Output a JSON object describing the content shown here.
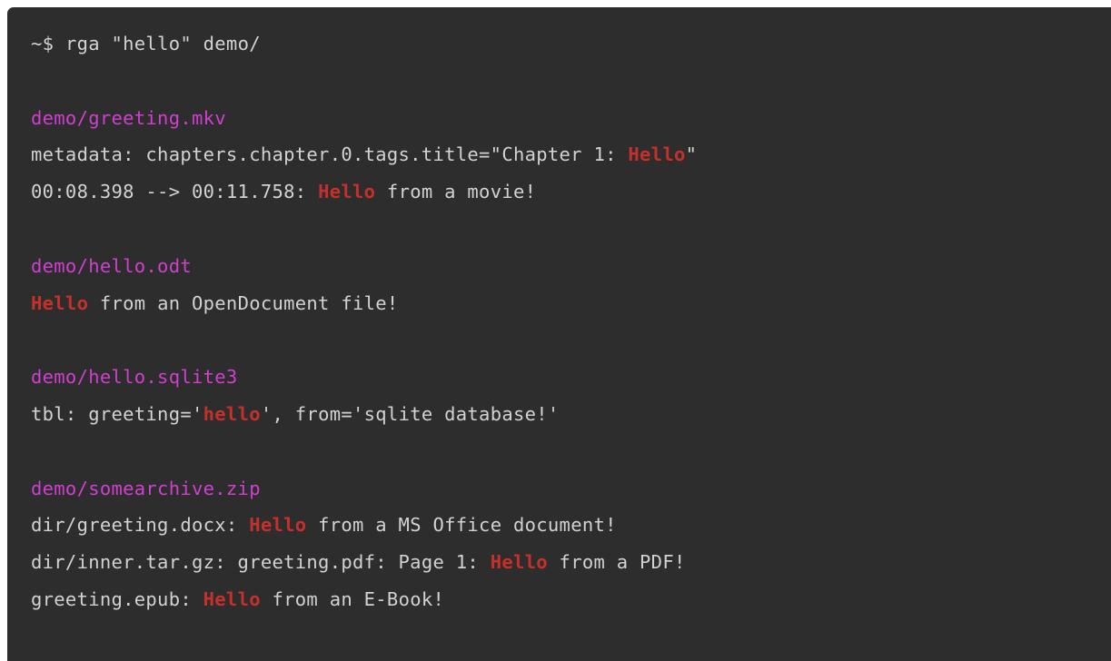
{
  "terminal": {
    "background_color": "#2d2d2d",
    "foreground_color": "#d2d2d2",
    "path_color": "#d13fd1",
    "match_color": "#c6302a",
    "page_background_color": "#ffffff",
    "command": "~$ rga \"hello\" demo/",
    "prompt": "~$ ",
    "program": "rga",
    "query": "hello",
    "search_path": "demo/",
    "lines": [
      {
        "type": "command",
        "segments": [
          {
            "kind": "prompt",
            "text": "~$ "
          },
          {
            "kind": "normal",
            "text": "rga \"hello\" demo/"
          }
        ]
      },
      {
        "type": "blank",
        "segments": []
      },
      {
        "type": "filename",
        "segments": [
          {
            "kind": "path",
            "text": "demo/greeting.mkv"
          }
        ]
      },
      {
        "type": "result",
        "segments": [
          {
            "kind": "normal",
            "text": "metadata: chapters.chapter.0.tags.title=\"Chapter 1: "
          },
          {
            "kind": "match",
            "text": "Hello"
          },
          {
            "kind": "normal",
            "text": "\""
          }
        ]
      },
      {
        "type": "result",
        "segments": [
          {
            "kind": "normal",
            "text": "00:08.398 --> 00:11.758: "
          },
          {
            "kind": "match",
            "text": "Hello"
          },
          {
            "kind": "normal",
            "text": " from a movie!"
          }
        ]
      },
      {
        "type": "blank",
        "segments": []
      },
      {
        "type": "filename",
        "segments": [
          {
            "kind": "path",
            "text": "demo/hello.odt"
          }
        ]
      },
      {
        "type": "result",
        "segments": [
          {
            "kind": "match",
            "text": "Hello"
          },
          {
            "kind": "normal",
            "text": " from an OpenDocument file!"
          }
        ]
      },
      {
        "type": "blank",
        "segments": []
      },
      {
        "type": "filename",
        "segments": [
          {
            "kind": "path",
            "text": "demo/hello.sqlite3"
          }
        ]
      },
      {
        "type": "result",
        "segments": [
          {
            "kind": "normal",
            "text": "tbl: greeting='"
          },
          {
            "kind": "match",
            "text": "hello"
          },
          {
            "kind": "normal",
            "text": "', from='sqlite database!'"
          }
        ]
      },
      {
        "type": "blank",
        "segments": []
      },
      {
        "type": "filename",
        "segments": [
          {
            "kind": "path",
            "text": "demo/somearchive.zip"
          }
        ]
      },
      {
        "type": "result",
        "segments": [
          {
            "kind": "normal",
            "text": "dir/greeting.docx: "
          },
          {
            "kind": "match",
            "text": "Hello"
          },
          {
            "kind": "normal",
            "text": " from a MS Office document!"
          }
        ]
      },
      {
        "type": "result",
        "segments": [
          {
            "kind": "normal",
            "text": "dir/inner.tar.gz: greeting.pdf: Page 1: "
          },
          {
            "kind": "match",
            "text": "Hello"
          },
          {
            "kind": "normal",
            "text": " from a PDF!"
          }
        ]
      },
      {
        "type": "result",
        "segments": [
          {
            "kind": "normal",
            "text": "greeting.epub: "
          },
          {
            "kind": "match",
            "text": "Hello"
          },
          {
            "kind": "normal",
            "text": " from an E-Book!"
          }
        ]
      }
    ]
  }
}
